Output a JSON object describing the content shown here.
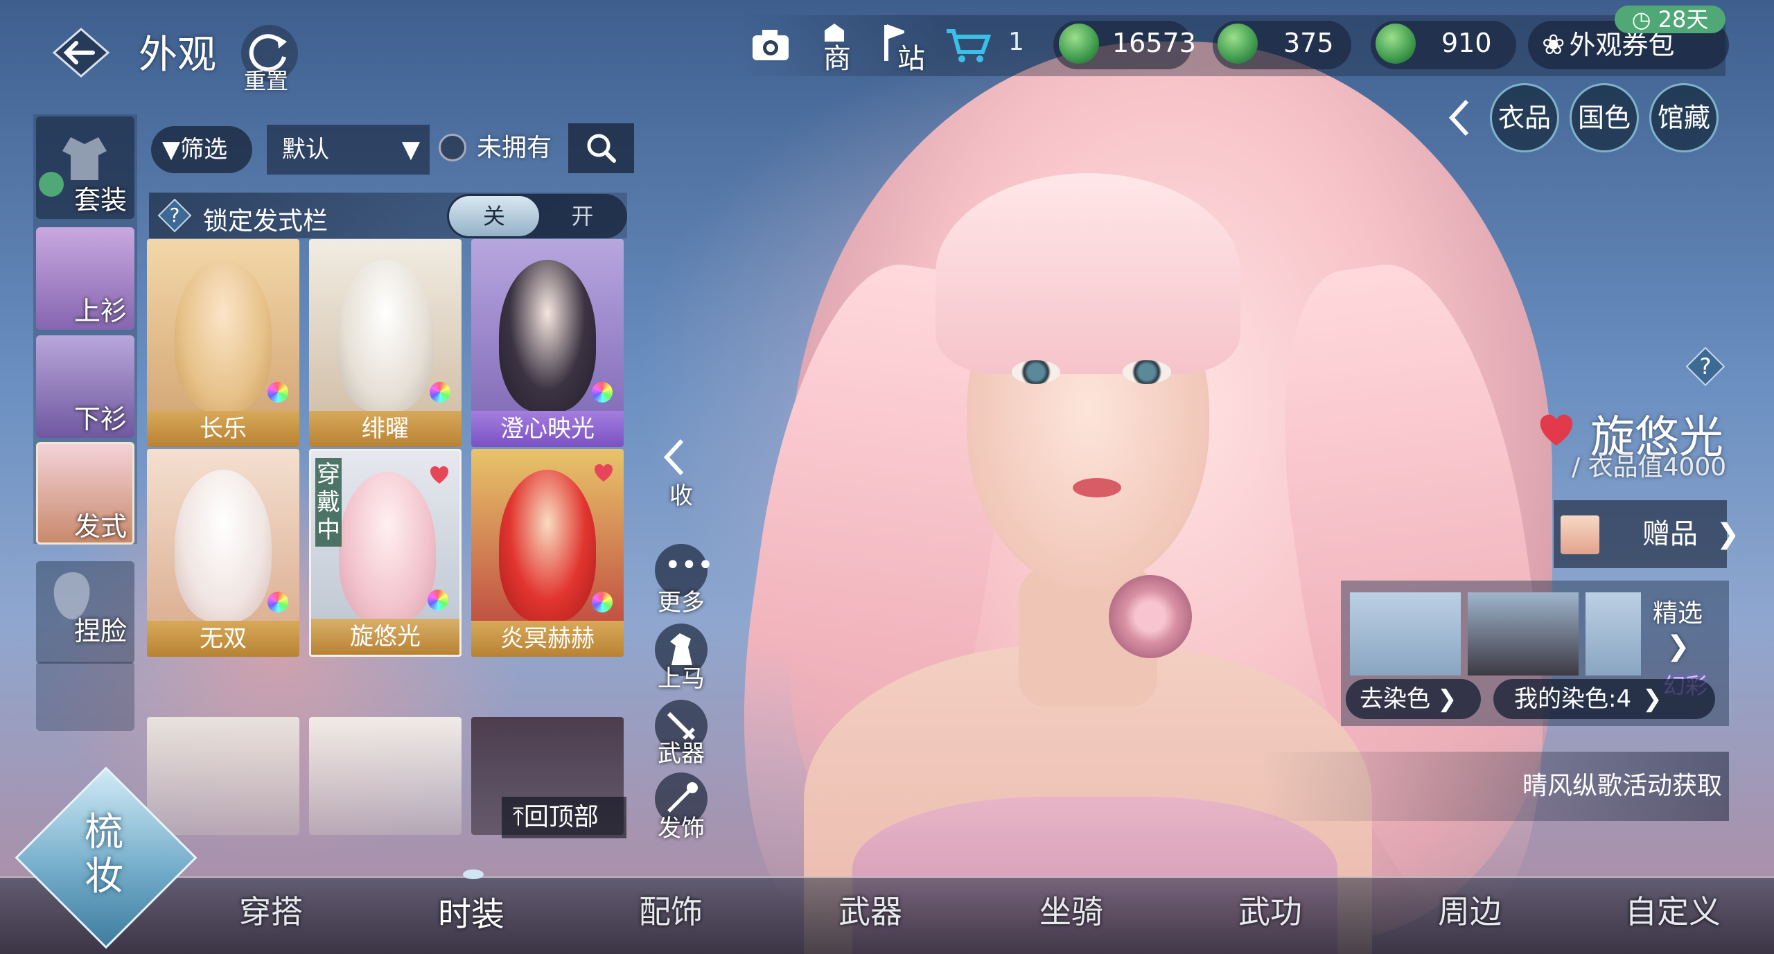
{
  "header": {
    "title": "外观",
    "reset_label": "重置"
  },
  "left_tabs": [
    {
      "label": "套装"
    },
    {
      "label": "上衫"
    },
    {
      "label": "下衫"
    },
    {
      "label": "发式"
    },
    {
      "label": "捏脸"
    }
  ],
  "filters": {
    "filter_label": "筛选",
    "sort_value": "默认",
    "unowned_label": "未拥有"
  },
  "lock_row": {
    "label": "锁定发式栏",
    "on_label": "关",
    "off_label": "开"
  },
  "grid": {
    "items": [
      {
        "name": "长乐"
      },
      {
        "name": "绯曜"
      },
      {
        "name": "澄心映光"
      },
      {
        "name": "无双"
      },
      {
        "name": "旋悠光",
        "badge": "穿戴中"
      },
      {
        "name": "炎冥赫赫"
      }
    ],
    "back_to_top": "回顶部"
  },
  "side_actions": {
    "collapse": "收",
    "more": "更多",
    "mount": "上马",
    "weapon": "武器",
    "hair_accessory": "发饰"
  },
  "topbar": {
    "shop_label": "商",
    "station_label": "站",
    "cart_count": "1",
    "currency": [
      {
        "value": "16573",
        "color": "#3f9a4e"
      },
      {
        "value": "375",
        "color": "#3f9a4e"
      },
      {
        "value": "910",
        "color": "#3f9a4e"
      }
    ],
    "voucher_label": "外观券包",
    "voucher_days": "28天"
  },
  "right_buttons": {
    "item": "衣品",
    "color": "国色",
    "collection": "馆藏"
  },
  "item": {
    "name": "旋悠光",
    "value_label": "/ 衣品值4000",
    "gift_label": "赠品"
  },
  "dye": {
    "selected_label": "精选",
    "remove_label": "去染色",
    "my_dye_label": "我的染色:4",
    "tag": "幻彩"
  },
  "source": "晴风纵歌活动获取",
  "bottom_nav": {
    "main_label": "梳妆",
    "items": [
      "穿搭",
      "时装",
      "配饰",
      "武器",
      "坐骑",
      "武功",
      "周边",
      "自定义"
    ],
    "active_index": 1
  },
  "colors": {
    "accent_gold": "#c8963f",
    "toggle_on": "#cfe0ec",
    "active_green": "#4fa876"
  }
}
